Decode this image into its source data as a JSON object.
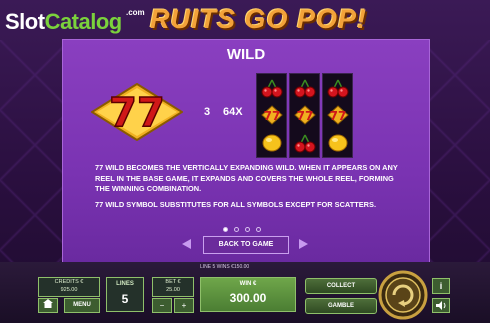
{
  "logo": {
    "slot": "Slot",
    "catalog": "Catalog",
    "com": ".com"
  },
  "game_title": "RUITS GO POP!",
  "paytable": {
    "title": "WILD",
    "symbol_count": "3",
    "multiplier": "64X",
    "description_1": "77 WILD BECOMES THE VERTICALLY EXPANDING WILD. WHEN IT APPEARS ON ANY REEL IN THE BASE GAME, IT EXPANDS AND COVERS THE WHOLE REEL, FORMING THE WINNING COMBINATION.",
    "description_2": "77 WILD SYMBOL SUBSTITUTES FOR ALL SYMBOLS EXCEPT FOR SCATTERS.",
    "back_label": "BACK TO GAME",
    "page_dots": 4,
    "active_page": 1,
    "example_reels": [
      [
        "cherry",
        "77-wild",
        "lemon"
      ],
      [
        "cherry",
        "77-wild",
        "cherry"
      ],
      [
        "cherry",
        "77-wild",
        "lemon"
      ]
    ]
  },
  "bottom_bar": {
    "line_win_label": "LINE 5 WINS €150.00",
    "credits_label": "CREDITS €",
    "credits_value": "925.00",
    "menu_label": "MENU",
    "lines_label": "LINES",
    "lines_value": "5",
    "bet_label": "BET €",
    "bet_value": "25.00",
    "win_label": "WIN €",
    "win_value": "300.00",
    "collect_label": "COLLECT",
    "gamble_label": "GAMBLE",
    "info_label": "i"
  },
  "colors": {
    "panel": "#7a33b2",
    "accent_green": "#8fc06a",
    "logo_green": "#7bd23c"
  }
}
